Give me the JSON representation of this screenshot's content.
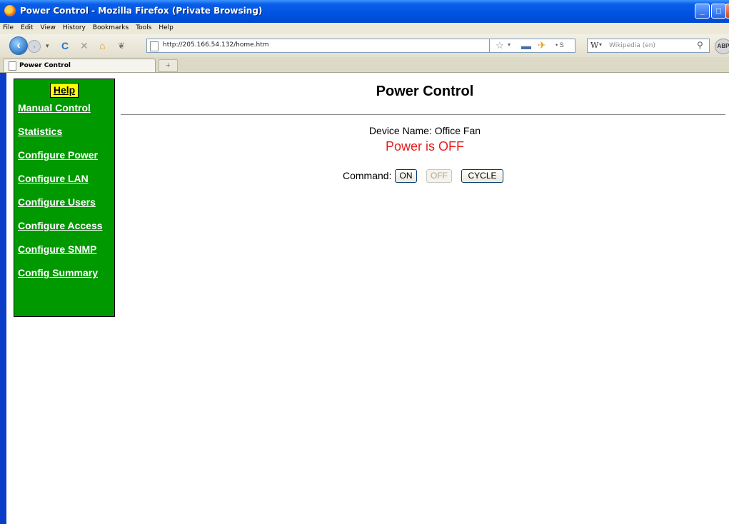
{
  "window": {
    "title": "Power Control - Mozilla Firefox (Private Browsing)",
    "controls": {
      "minimize": "_",
      "maximize": "□",
      "close": "X"
    }
  },
  "menu": [
    "File",
    "Edit",
    "View",
    "History",
    "Bookmarks",
    "Tools",
    "Help"
  ],
  "address_bar": {
    "url": "http://205.166.54.132/home.htm"
  },
  "search_bar": {
    "engine_icon": "W",
    "placeholder": "Wikipedia (en)"
  },
  "toolbar_icons": [
    "back-icon",
    "forward-icon",
    "reload-icon",
    "stop-icon",
    "home-icon",
    "paw-icon",
    "bookmark-star-icon",
    "print-icon",
    "addon-icon",
    "stumble-icon",
    "search-go-icon",
    "adblock-icon"
  ],
  "addon_label": "ABP",
  "tab": {
    "label": "Power Control",
    "new_tab": "+"
  },
  "sidebar": {
    "help_label": "Help",
    "links": [
      "Manual Control",
      "Statistics",
      "Configure Power",
      "Configure LAN",
      "Configure Users",
      "Configure Access",
      "Configure SNMP",
      "Config Summary"
    ]
  },
  "main": {
    "title": "Power Control",
    "device_name": "Device Name: Office Fan",
    "power_status": "Power is OFF",
    "command_label": "Command:",
    "buttons": {
      "on": "ON",
      "off": "OFF",
      "cycle": "CYCLE"
    }
  },
  "colors": {
    "sidebar_bg": "#009900",
    "help_bg": "#ffff00",
    "status_off": "#e51c1c"
  }
}
